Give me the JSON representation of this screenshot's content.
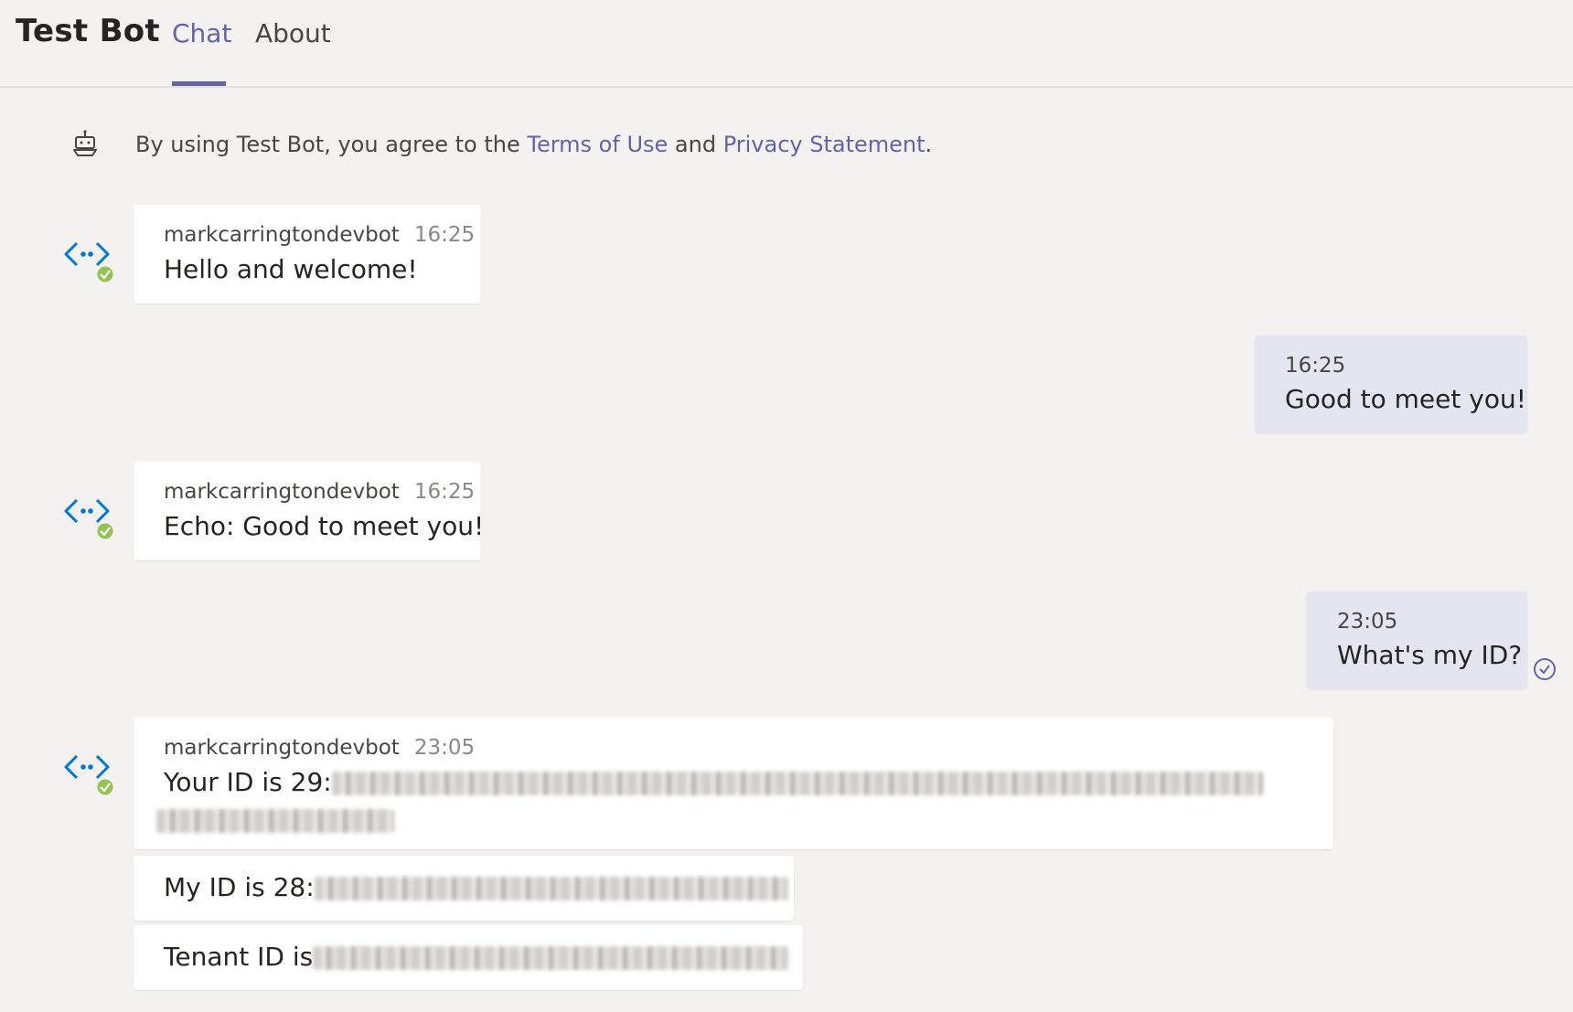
{
  "header": {
    "app_title": "Test Bot",
    "tabs": [
      {
        "label": "Chat",
        "active": true
      },
      {
        "label": "About",
        "active": false
      }
    ]
  },
  "notice": {
    "prefix": "By using Test Bot, you agree to the ",
    "terms_link": "Terms of Use",
    "middle": " and ",
    "privacy_link": "Privacy Statement",
    "suffix": "."
  },
  "messages": [
    {
      "from": "bot",
      "sender": "markcarringtondevbot",
      "time": "16:25",
      "text": "Hello and welcome!"
    },
    {
      "from": "me",
      "time": "16:25",
      "text": "Good to meet you!"
    },
    {
      "from": "bot",
      "sender": "markcarringtondevbot",
      "time": "16:25",
      "text": "Echo: Good to meet you!"
    },
    {
      "from": "me",
      "time": "23:05",
      "text": "What's my ID?"
    },
    {
      "from": "bot",
      "sender": "markcarringtondevbot",
      "time": "23:05",
      "text": "Your ID is 29:"
    },
    {
      "from": "bot",
      "text": "My ID is 28:"
    },
    {
      "from": "bot",
      "text": "Tenant ID is"
    }
  ],
  "colors": {
    "accent": "#6264a7",
    "bot_icon_blue": "#0078d4",
    "presence_green": "#92c353",
    "my_bubble": "#e5e5f1",
    "background": "#f3f2f1"
  },
  "icons": {
    "notice": "bot-icon",
    "avatar": "code-brackets-icon",
    "presence": "available-check-icon",
    "read_receipt": "read-check-icon"
  }
}
